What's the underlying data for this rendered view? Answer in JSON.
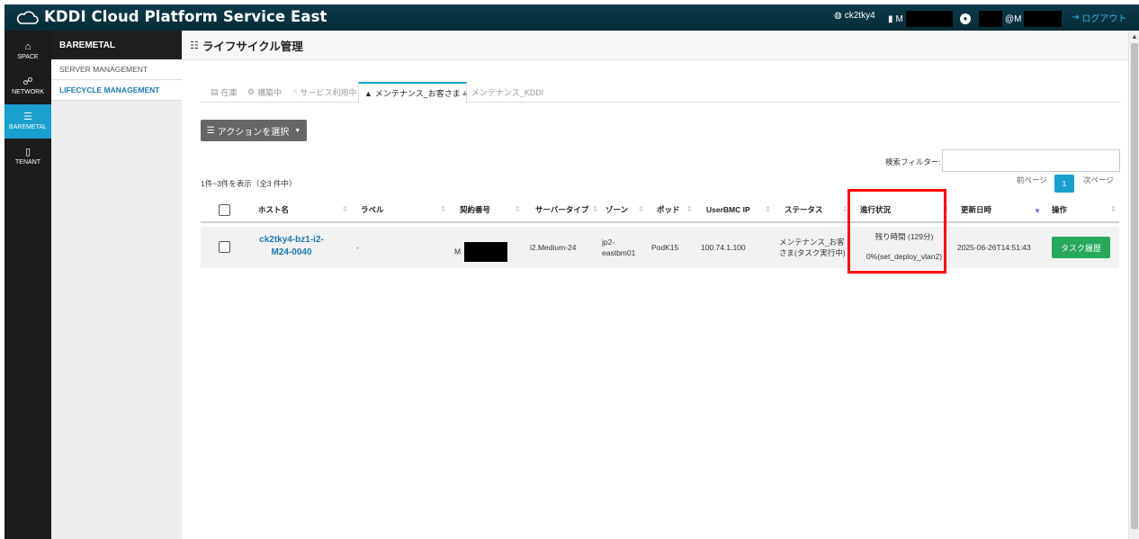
{
  "header": {
    "brand": "KDDI Cloud Platform Service East",
    "tenant": "ck2tky4",
    "contract_prefix": "M",
    "user_prefix": "@M",
    "logout": "ログアウト"
  },
  "iconbar": [
    {
      "label": "SPACE",
      "icon": "home-icon",
      "active": false
    },
    {
      "label": "NETWORK",
      "icon": "network-icon",
      "active": false
    },
    {
      "label": "BAREMETAL",
      "icon": "server-icon",
      "active": true
    },
    {
      "label": "TENANT",
      "icon": "building-icon",
      "active": false
    }
  ],
  "subbar": {
    "title": "BAREMETAL",
    "items": [
      {
        "label": "SERVER MANAGEMENT",
        "active": false
      },
      {
        "label": "LIFECYCLE MANAGEMENT",
        "active": true
      }
    ]
  },
  "page": {
    "title": "ライフサイクル管理"
  },
  "tabs": [
    {
      "label": "在庫",
      "icon": "stock-icon",
      "active": false
    },
    {
      "label": "構築中",
      "icon": "gears-icon",
      "active": false
    },
    {
      "label": "サービス利用中",
      "icon": "thumb-icon",
      "active": false
    },
    {
      "label": "メンテナンス_お客さま",
      "icon": "warning-icon",
      "active": true
    },
    {
      "label": "メンテナンス_KDDI",
      "icon": "warning-icon",
      "active": false
    }
  ],
  "toolbar": {
    "action_label": "アクションを選択"
  },
  "filter": {
    "label": "検索フィルター:",
    "value": ""
  },
  "count_text": "1件~3件を表示（全3 件中）",
  "pager": {
    "prev": "前ページ",
    "current": "1",
    "next": "次ページ"
  },
  "table": {
    "columns": [
      "ホスト名",
      "ラベル",
      "契約番号",
      "サーバータイプ",
      "ゾーン",
      "ポッド",
      "UserBMC IP",
      "ステータス",
      "進行状況",
      "更新日時",
      "操作"
    ],
    "rows": [
      {
        "host_line1": "ck2tky4-bz1-i2-",
        "host_line2": "M24-0040",
        "label": "-",
        "contract": "M",
        "server_type": "i2.Medium-24",
        "zone_line1": "jp2-",
        "zone_line2": "eastbm01",
        "pod": "PodK15",
        "ip": "100.74.1.100",
        "status_line1": "メンテナンス_お客",
        "status_line2": "さま(タスク実行中)",
        "progress_line1": "残り時間 (129分)",
        "progress_line2": "0%(set_deploy_vlan2)",
        "updated": "2025-06-26T14:51:43",
        "action": "タスク履歴"
      }
    ]
  }
}
